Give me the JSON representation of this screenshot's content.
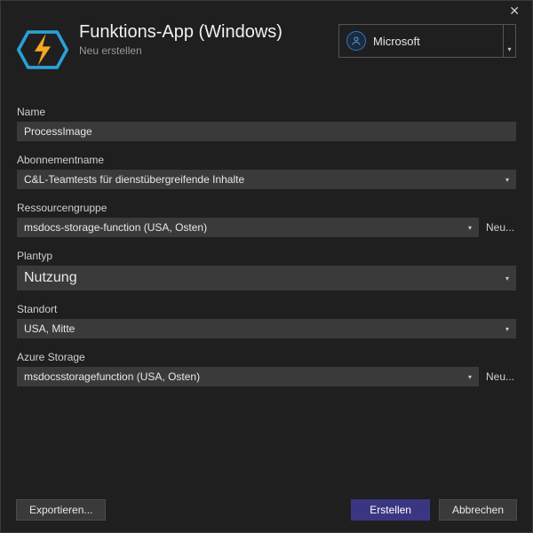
{
  "header": {
    "title": "Funktions-App (Windows)",
    "subtitle": "Neu erstellen"
  },
  "account": {
    "name": "Microsoft"
  },
  "fields": {
    "name": {
      "label": "Name",
      "value": "ProcessImage"
    },
    "subscription": {
      "label": "Abonnementname",
      "value": "C&L-Teamtests für dienstübergreifende Inhalte"
    },
    "resourceGroup": {
      "label": "Ressourcengruppe",
      "value": "msdocs-storage-function (USA, Osten)",
      "new": "Neu..."
    },
    "planType": {
      "label": "Plantyp",
      "value": "Nutzung"
    },
    "location": {
      "label": "Standort",
      "value": "USA, Mitte"
    },
    "storage": {
      "label": "Azure Storage",
      "value": "msdocsstoragefunction (USA, Osten)",
      "new": "Neu..."
    }
  },
  "footer": {
    "export": "Exportieren...",
    "create": "Erstellen",
    "cancel": "Abbrechen"
  }
}
